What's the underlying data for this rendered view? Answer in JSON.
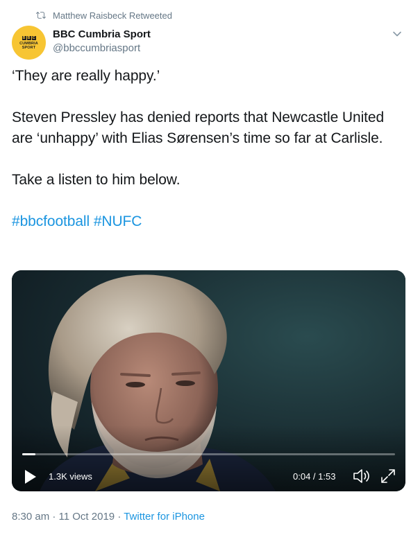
{
  "retweet": {
    "icon": "retweet-icon",
    "text": "Matthew Raisbeck Retweeted"
  },
  "author": {
    "avatar": {
      "icon": "bbc-cumbria-sport-logo",
      "logo_letters": [
        "B",
        "B",
        "C"
      ],
      "line1": "CUMBRIA",
      "line2": "SPORT",
      "color": "#f7c533"
    },
    "display_name": "BBC Cumbria Sport",
    "handle": "@bbccumbriasport"
  },
  "menu": {
    "icon": "chevron-down-icon"
  },
  "text": {
    "line1": "‘They are really happy.’",
    "line2": "Steven Pressley has denied reports that Newcastle United are ‘unhappy’ with Elias Sørensen’s time so far at Carlisle.",
    "line3": "Take a listen to him below.",
    "hashtags": [
      "#bbcfootball",
      "#NUFC"
    ]
  },
  "video": {
    "views": "1.3K views",
    "time": "0:04 / 1:53",
    "progress": 0.035,
    "play_icon": "play-icon",
    "volume_icon": "volume-icon",
    "fullscreen_icon": "fullscreen-icon"
  },
  "meta": {
    "timestamp": "8:30 am · 11 Oct 2019",
    "separator": "·",
    "source": "Twitter for iPhone"
  },
  "colors": {
    "link": "#1b95e0",
    "secondary": "#657786",
    "text": "#14171a"
  }
}
